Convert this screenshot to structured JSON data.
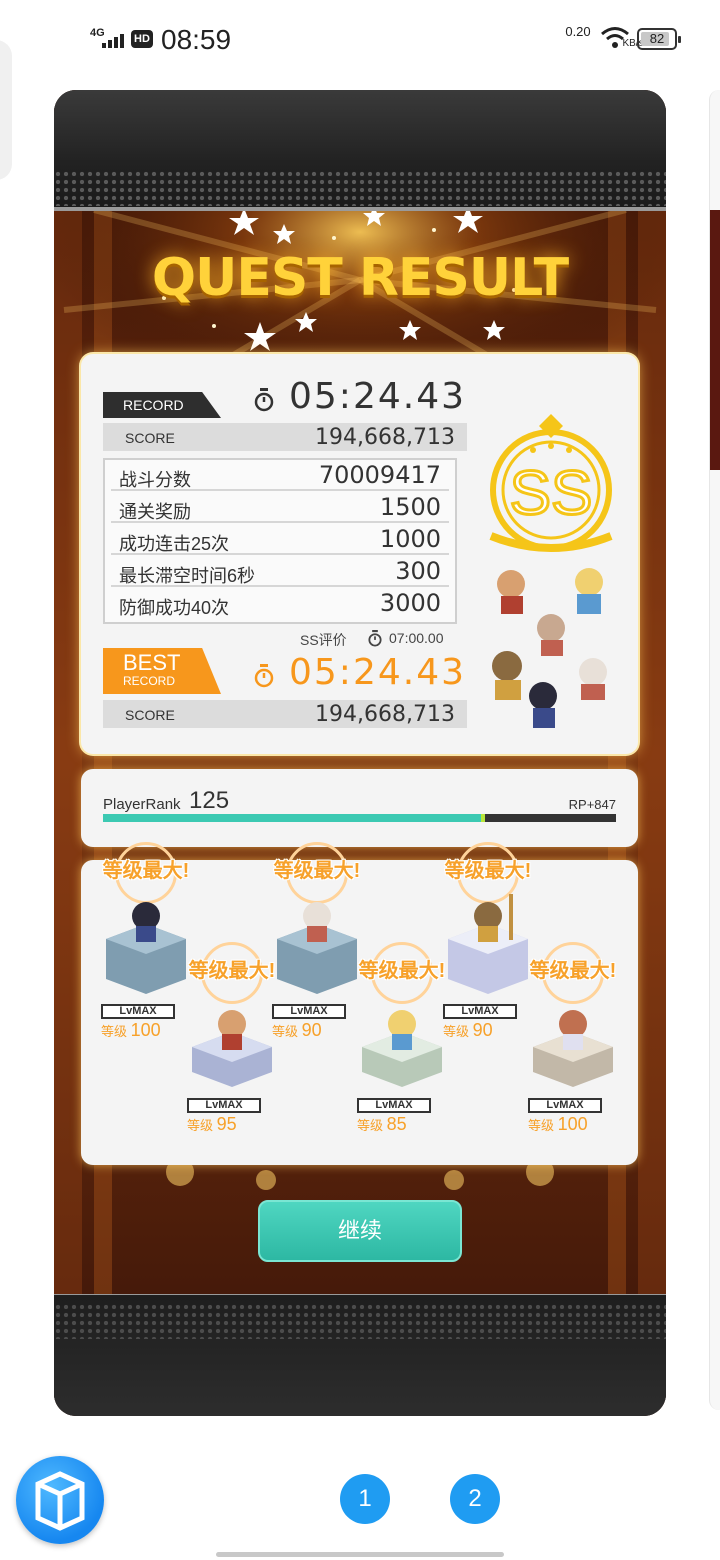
{
  "status_bar": {
    "network": "4G",
    "hd": "HD",
    "time": "08:59",
    "speed_value": "0.20",
    "speed_unit": "KB/s",
    "battery": "82"
  },
  "game": {
    "title": "QUEST RESULT",
    "record": {
      "tag": "RECORD",
      "time": "05:24.43",
      "score_label": "SCORE",
      "score": "194,668,713",
      "bonuses": [
        {
          "label": "战斗分数",
          "value": "70009417"
        },
        {
          "label": "通关奖励",
          "value": "1500"
        },
        {
          "label": "成功连击25次",
          "value": "1000"
        },
        {
          "label": "最长滞空时间6秒",
          "value": "300"
        },
        {
          "label": "防御成功40次",
          "value": "3000"
        }
      ],
      "ss_eval_label": "SS评价",
      "ss_target_time": "07:00.00",
      "rank_badge": "SS"
    },
    "best": {
      "tag_line1": "BEST",
      "tag_line2": "RECORD",
      "time": "05:24.43",
      "score_label": "SCORE",
      "score": "194,668,713"
    },
    "player_rank": {
      "label": "PlayerRank",
      "value": "125",
      "rp": "RP+847",
      "progress": 0.74
    },
    "party": [
      {
        "max_label": "等级最大!",
        "lvmax": "LvMAX",
        "level_label": "等级",
        "level": "100",
        "pedestal": "#7f9db0",
        "hair": "#2a2a3a",
        "outfit": "#3a4a8a"
      },
      {
        "max_label": "等级最大!",
        "lvmax": "LvMAX",
        "level_label": "等级",
        "level": "95",
        "pedestal": "#c9cfe6",
        "hair": "#d8a070",
        "outfit": "#b04030"
      },
      {
        "max_label": "等级最大!",
        "lvmax": "LvMAX",
        "level_label": "等级",
        "level": "90",
        "pedestal": "#7f9db0",
        "hair": "#e8e0d8",
        "outfit": "#c06050"
      },
      {
        "max_label": "等级最大!",
        "lvmax": "LvMAX",
        "level_label": "等级",
        "level": "85",
        "pedestal": "#d4e0d4",
        "hair": "#f0d070",
        "outfit": "#5a9ad0"
      },
      {
        "max_label": "等级最大!",
        "lvmax": "LvMAX",
        "level_label": "等级",
        "level": "90",
        "pedestal": "#dde0f0",
        "hair": "#8a6a40",
        "outfit": "#d0a040"
      },
      {
        "max_label": "等级最大!",
        "lvmax": "LvMAX",
        "level_label": "等级",
        "level": "100",
        "pedestal": "#d8d0c4",
        "hair": "#c07050",
        "outfit": "#e0e0f0"
      }
    ],
    "continue_label": "继续"
  },
  "pager": {
    "page1": "1",
    "page2": "2"
  },
  "colors": {
    "gold": "#ffd23a",
    "orange": "#f7971c",
    "teal": "#3cc9b2",
    "blue": "#1f9cf2"
  }
}
